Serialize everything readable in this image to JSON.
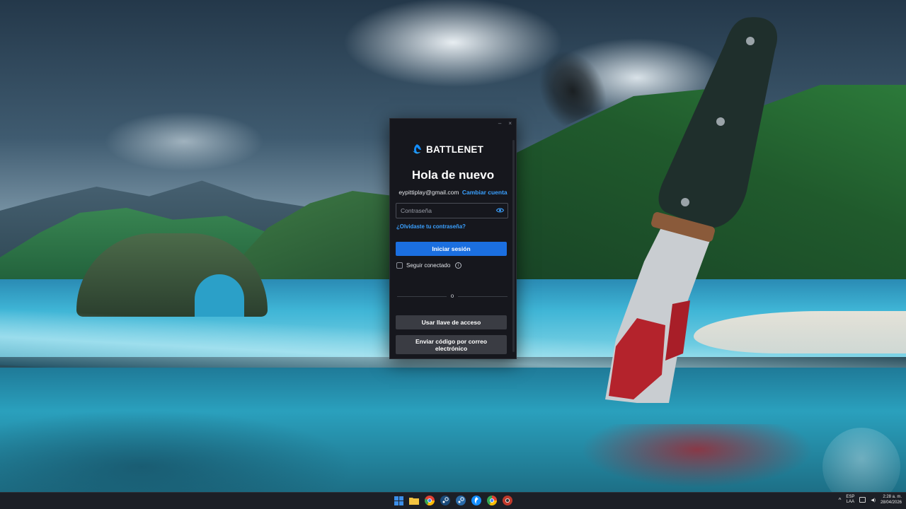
{
  "login_window": {
    "logo_text": "BATTLENET",
    "heading": "Hola de nuevo",
    "account_email": "eypittiplay@gmail.com",
    "change_account_link": "Cambiar cuenta",
    "password_placeholder": "Contraseña",
    "forgot_password_link": "¿Olvidaste tu contraseña?",
    "sign_in_button": "Iniciar sesión",
    "keep_signed_in_label": "Seguir conectado",
    "divider_text": "o",
    "passkey_button": "Usar llave de acceso",
    "email_code_button": "Enviar código por correo electrónico",
    "window_controls": {
      "minimize": "–",
      "close": "×"
    },
    "accent_color": "#1b6fe0",
    "link_color": "#3aa0ff"
  },
  "taskbar": {
    "apps": [
      {
        "name": "windows-start-icon",
        "color": "#3b8ee8"
      },
      {
        "name": "file-explorer-icon",
        "color": "#f3c340"
      },
      {
        "name": "chrome-icon",
        "color": "#e34133"
      },
      {
        "name": "steam-icon",
        "color": "#1b4b7a"
      },
      {
        "name": "steam-icon-2",
        "color": "#2a6aa8"
      },
      {
        "name": "battlenet-icon",
        "color": "#148eff"
      },
      {
        "name": "chrome-icon-2",
        "color": "#34a853"
      },
      {
        "name": "chrome-dev-icon",
        "color": "#c0392b"
      }
    ],
    "tray": {
      "language_top": "ESP",
      "language_bottom": "LAA",
      "time": "2:28 a. m.",
      "date": "28/04/2026"
    }
  }
}
